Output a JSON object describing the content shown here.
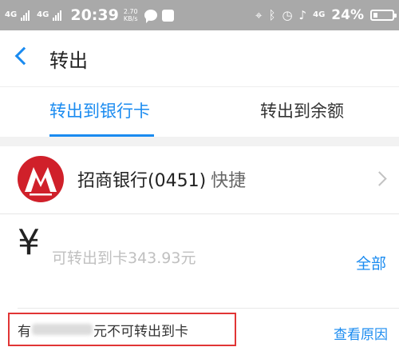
{
  "status_bar": {
    "network_left_1": "4G",
    "network_left_2": "4G",
    "time": "20:39",
    "speed_value": "2.70",
    "speed_unit": "KB/s",
    "network_right": "4G",
    "battery": "24%"
  },
  "nav": {
    "title": "转出"
  },
  "tabs": {
    "items": [
      {
        "label": "转出到银行卡",
        "active": true
      },
      {
        "label": "转出到余额",
        "active": false
      }
    ]
  },
  "bank": {
    "name": "招商银行(0451)",
    "tag": "快捷",
    "logo_color": "#d0202a"
  },
  "amount": {
    "currency_symbol": "¥",
    "placeholder": "可转出到卡343.93元",
    "all_label": "全部"
  },
  "notice": {
    "prefix": "有",
    "suffix": "元不可转出到卡",
    "link_label": "查看原因"
  },
  "colors": {
    "accent": "#1a8bf0",
    "highlight_border": "#e13535",
    "status_bar_bg": "#a9a9a9"
  }
}
